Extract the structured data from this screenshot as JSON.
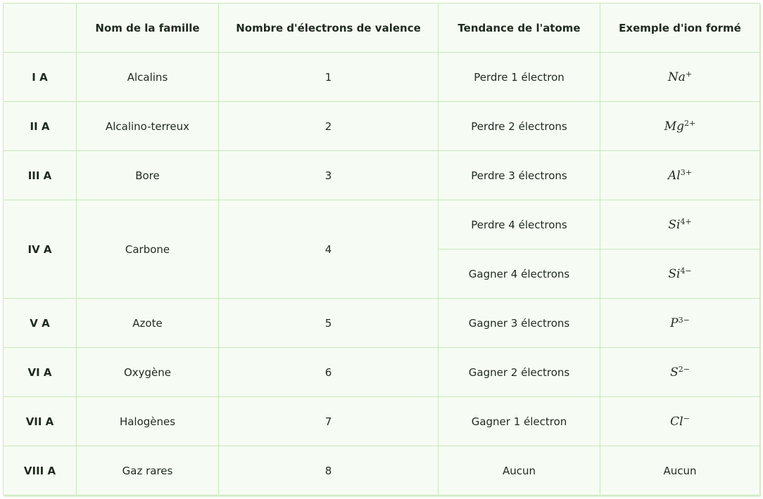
{
  "headers": [
    "",
    "Nom de la famille",
    "Nombre d'électrons de valence",
    "Tendance de l'atome",
    "Exemple d'ion formé"
  ],
  "rows": [
    {
      "group": "I A",
      "family": "Alcalins",
      "valence": "1",
      "tendency": "Perdre 1 électron",
      "ion": {
        "symbol": "Na",
        "charge": "+"
      }
    },
    {
      "group": "II A",
      "family": "Alcalino-terreux",
      "valence": "2",
      "tendency": "Perdre 2 électrons",
      "ion": {
        "symbol": "Mg",
        "charge": "2+"
      }
    },
    {
      "group": "III A",
      "family": "Bore",
      "valence": "3",
      "tendency": "Perdre 3 électrons",
      "ion": {
        "symbol": "Al",
        "charge": "3+"
      }
    },
    {
      "group": "IV A",
      "family": "Carbone",
      "valence": "4",
      "tendency": "Perdre 4 électrons",
      "ion": {
        "symbol": "Si",
        "charge": "4+"
      }
    },
    {
      "tendency": "Gagner 4 électrons",
      "ion": {
        "symbol": "Si",
        "charge": "4−"
      }
    },
    {
      "group": "V A",
      "family": "Azote",
      "valence": "5",
      "tendency": "Gagner 3 électrons",
      "ion": {
        "symbol": "P",
        "charge": "3−"
      }
    },
    {
      "group": "VI A",
      "family": "Oxygène",
      "valence": "6",
      "tendency": "Gagner 2 électrons",
      "ion": {
        "symbol": "S",
        "charge": "2−"
      }
    },
    {
      "group": "VII A",
      "family": "Halogènes",
      "valence": "7",
      "tendency": "Gagner 1 électron",
      "ion": {
        "symbol": "Cl",
        "charge": "−"
      }
    },
    {
      "group": "VIII A",
      "family": "Gaz rares",
      "valence": "8",
      "tendency": "Aucun",
      "ion_text": "Aucun"
    }
  ]
}
